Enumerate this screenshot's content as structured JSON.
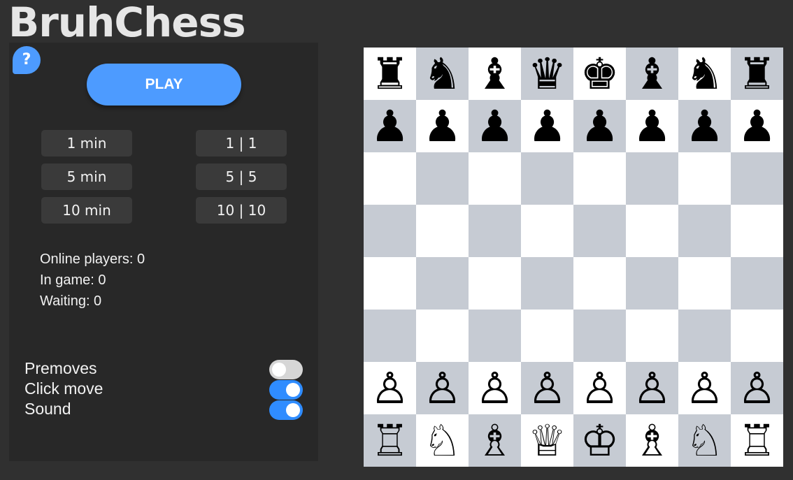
{
  "app": {
    "logo": "BruhChess",
    "help_label": "?"
  },
  "lobby": {
    "play_label": "PLAY",
    "time_controls": [
      "1 min",
      "1 | 1",
      "5 min",
      "5 | 5",
      "10 min",
      "10 | 10"
    ],
    "stats": {
      "online": "Online players: 0",
      "in_game": "In game: 0",
      "waiting": "Waiting: 0"
    }
  },
  "settings": [
    {
      "label": "Premoves",
      "enabled": false
    },
    {
      "label": "Click move",
      "enabled": true
    },
    {
      "label": "Sound",
      "enabled": true
    }
  ],
  "colors": {
    "accent": "#4d9bff",
    "toggle_on": "#2f8cff",
    "light_square": "#ffffff",
    "dark_square": "#c6cbd3"
  },
  "board": {
    "ranks": [
      [
        "♜",
        "♞",
        "♝",
        "♛",
        "♚",
        "♝",
        "♞",
        "♜"
      ],
      [
        "♟",
        "♟",
        "♟",
        "♟",
        "♟",
        "♟",
        "♟",
        "♟"
      ],
      [
        "",
        "",
        "",
        "",
        "",
        "",
        "",
        ""
      ],
      [
        "",
        "",
        "",
        "",
        "",
        "",
        "",
        ""
      ],
      [
        "",
        "",
        "",
        "",
        "",
        "",
        "",
        ""
      ],
      [
        "",
        "",
        "",
        "",
        "",
        "",
        "",
        ""
      ],
      [
        "♙",
        "♙",
        "♙",
        "♙",
        "♙",
        "♙",
        "♙",
        "♙"
      ],
      [
        "♖",
        "♘",
        "♗",
        "♕",
        "♔",
        "♗",
        "♘",
        "♖"
      ]
    ],
    "piece_names": [
      [
        "black-rook",
        "black-knight",
        "black-bishop",
        "black-queen",
        "black-king",
        "black-bishop",
        "black-knight",
        "black-rook"
      ],
      [
        "black-pawn",
        "black-pawn",
        "black-pawn",
        "black-pawn",
        "black-pawn",
        "black-pawn",
        "black-pawn",
        "black-pawn"
      ],
      [
        "",
        "",
        "",
        "",
        "",
        "",
        "",
        ""
      ],
      [
        "",
        "",
        "",
        "",
        "",
        "",
        "",
        ""
      ],
      [
        "",
        "",
        "",
        "",
        "",
        "",
        "",
        ""
      ],
      [
        "",
        "",
        "",
        "",
        "",
        "",
        "",
        ""
      ],
      [
        "white-pawn",
        "white-pawn",
        "white-pawn",
        "white-pawn",
        "white-pawn",
        "white-pawn",
        "white-pawn",
        "white-pawn"
      ],
      [
        "white-rook",
        "white-knight",
        "white-bishop",
        "white-queen",
        "white-king",
        "white-bishop",
        "white-knight",
        "white-rook"
      ]
    ]
  }
}
